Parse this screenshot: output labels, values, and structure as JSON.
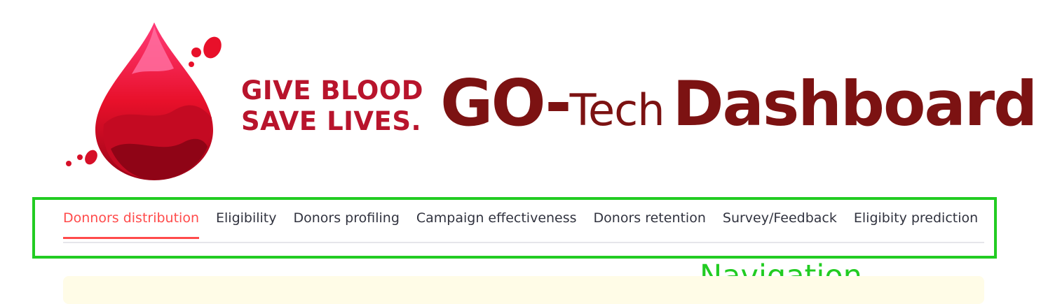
{
  "header": {
    "slogan_line1": "GIVE BLOOD",
    "slogan_line2": "SAVE LIVES.",
    "title_go": "GO-",
    "title_tech": "Tech",
    "title_dashboard": "Dashboard"
  },
  "tabs": [
    {
      "label": "Donnors distribution",
      "active": true
    },
    {
      "label": "Eligibility"
    },
    {
      "label": "Donors profiling"
    },
    {
      "label": "Campaign effectiveness"
    },
    {
      "label": "Donors retention"
    },
    {
      "label": "Survey/Feedback"
    },
    {
      "label": "Eligibity prediction"
    }
  ],
  "annotation": {
    "label": "Navigation",
    "color": "#22cc22"
  },
  "colors": {
    "accent": "#ff4b4b",
    "title": "#7c1212",
    "slogan": "#b8142c"
  }
}
